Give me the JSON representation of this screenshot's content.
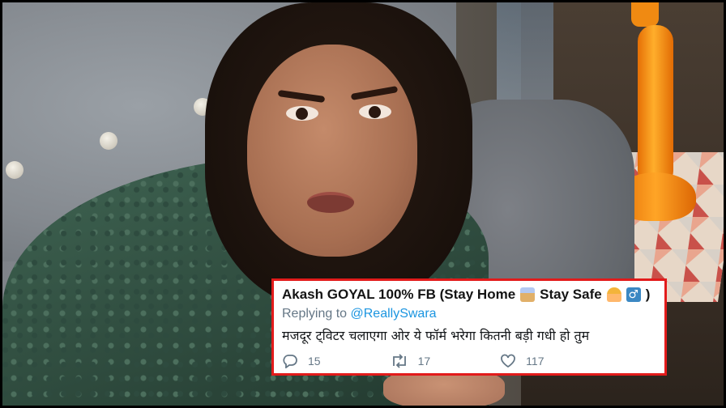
{
  "tweet": {
    "name": "Akash GOYAL 100% FB (Stay Home",
    "name_mid": "Stay Safe",
    "reply_prefix": "Replying to",
    "reply_handle": "@ReallySwara",
    "text": "मजदूर ट्विटर चलाएगा ओर ये फॉर्म भरेगा कितनी बड़ी गधी हो तुम",
    "male_symbol": "♂",
    "replies": "15",
    "retweets": "17",
    "likes": "117",
    "border_color": "#e21b1b",
    "handle_color": "#1b95e0",
    "icons": [
      "house-icon",
      "raising-hand-icon",
      "male-sign-icon",
      "reply-icon",
      "retweet-icon",
      "like-icon"
    ]
  },
  "photo": {
    "subject_clothing_color": "#3f6452",
    "lamp_color": "#f08a12",
    "sofa_color": "#858a90"
  }
}
